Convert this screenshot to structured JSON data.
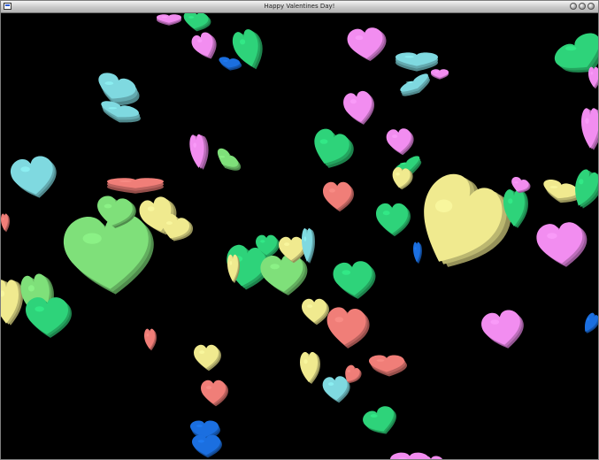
{
  "window": {
    "title": "Happy Valentines Day!",
    "icons": {
      "app": "app-window-icon",
      "minimize": "minimize-icon",
      "maximize": "maximize-icon",
      "close": "close-icon"
    }
  },
  "scene": {
    "background": "#000000",
    "description_colors": {
      "green": "#7fe07a",
      "bright_green": "#2ed37a",
      "cyan": "#7fd9e0",
      "yellow": "#f0ea8f",
      "pink": "#f28df0",
      "salmon": "#f07e78",
      "blue": "#1b6fe0"
    }
  }
}
